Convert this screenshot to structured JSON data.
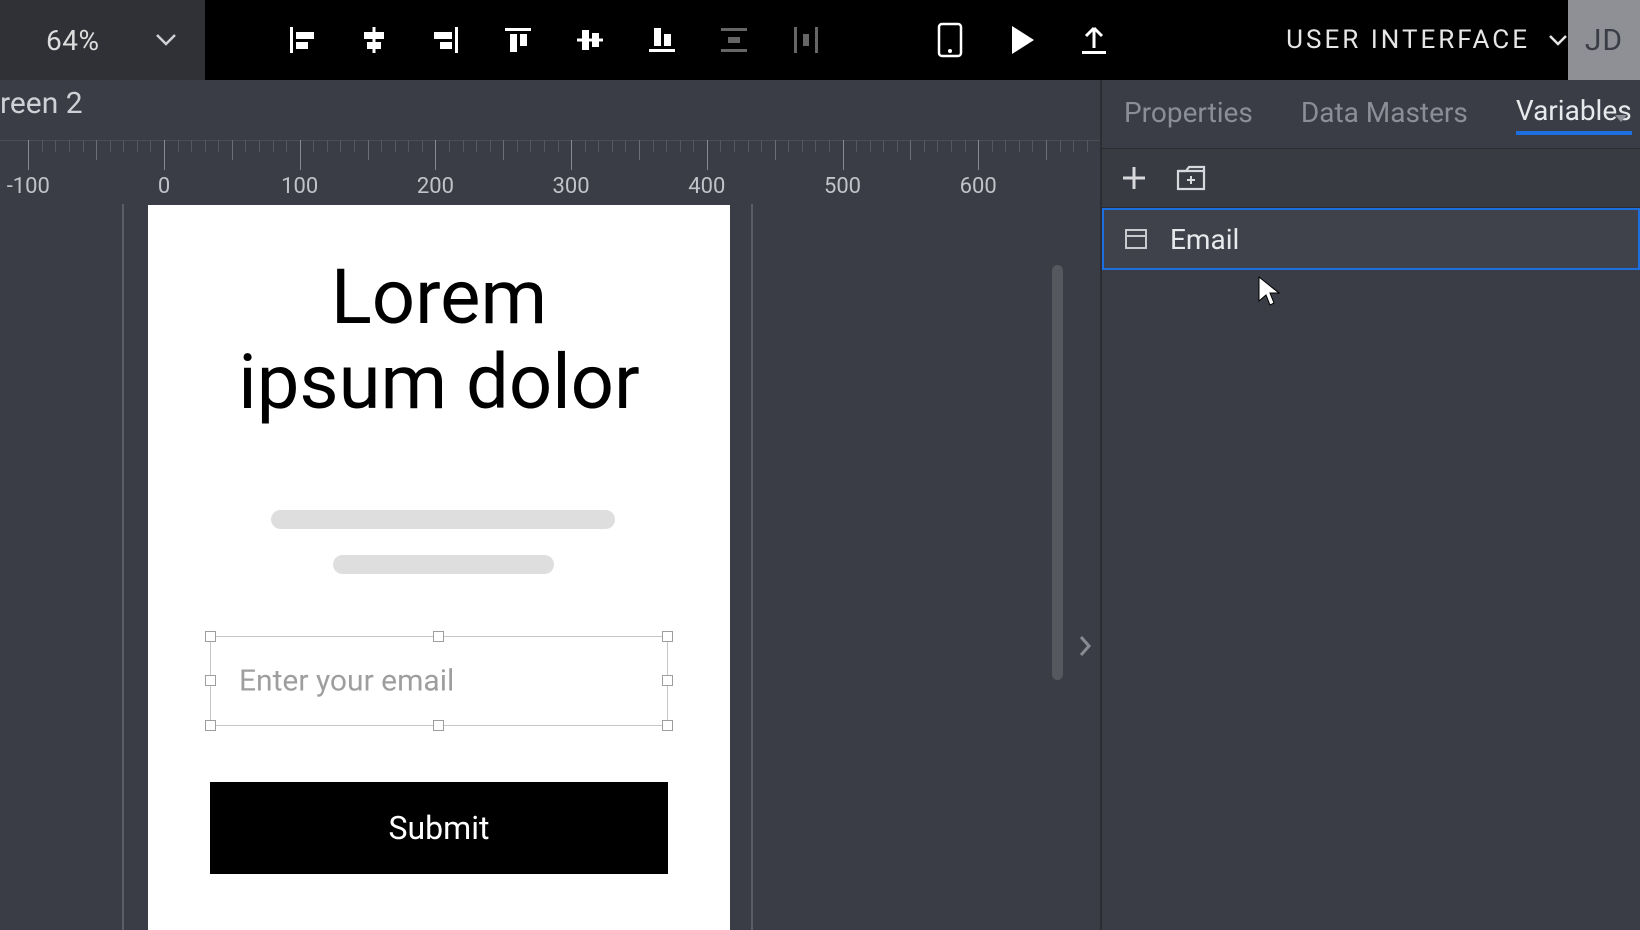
{
  "toolbar": {
    "zoom": "64%",
    "mode_label": "USER INTERFACE",
    "user_initials": "JD"
  },
  "canvas": {
    "screen_label": "reen 2",
    "ruler_major_ticks": [
      -100,
      0,
      100,
      200,
      300,
      400,
      500,
      600
    ],
    "artboard": {
      "title_line1": "Lorem",
      "title_line2": "ipsum dolor",
      "input_placeholder": "Enter your email",
      "submit_label": "Submit"
    }
  },
  "side_panel": {
    "tabs": {
      "properties": "Properties",
      "data_masters": "Data Masters",
      "variables": "Variables",
      "active": "variables"
    },
    "variables": [
      {
        "name": "Email"
      }
    ]
  }
}
